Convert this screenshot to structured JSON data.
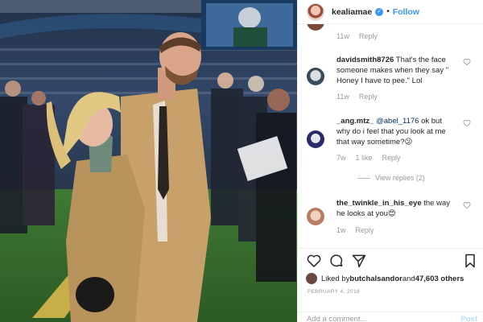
{
  "photo": {
    "scoreboard_text": ""
  },
  "header": {
    "username": "kealiamae",
    "separator": "•",
    "follow_label": "Follow"
  },
  "comments": [
    {
      "meta_time": "11w",
      "meta_reply": "Reply"
    },
    {
      "username": "davidsmith8726",
      "text": " That's the face someone makes when they say \" Honey I have to pee.\" Lol",
      "meta_time": "11w",
      "meta_reply": "Reply"
    },
    {
      "username": "_ang.mtz_",
      "mention": " @abel_1176",
      "text": " ok but why do i feel that you look at me that way sometime?😕",
      "meta_time": "7w",
      "meta_likes": "1 like",
      "meta_reply": "Reply",
      "view_replies": "View replies (2)"
    },
    {
      "username": "the_twinkle_in_his_eye",
      "text": " the way he looks at you😍",
      "meta_time": "1w",
      "meta_reply": "Reply"
    }
  ],
  "likes": {
    "prefix": "Liked by ",
    "user": "butchalsandor",
    "middle": " and ",
    "count": "47,603 others"
  },
  "date": "FEBRUARY 4, 2018",
  "add_comment": {
    "placeholder": "Add a comment...",
    "post_label": "Post"
  },
  "colors": {
    "link": "#3897f0",
    "muted": "#999999",
    "post_disabled": "#b2dffc"
  }
}
